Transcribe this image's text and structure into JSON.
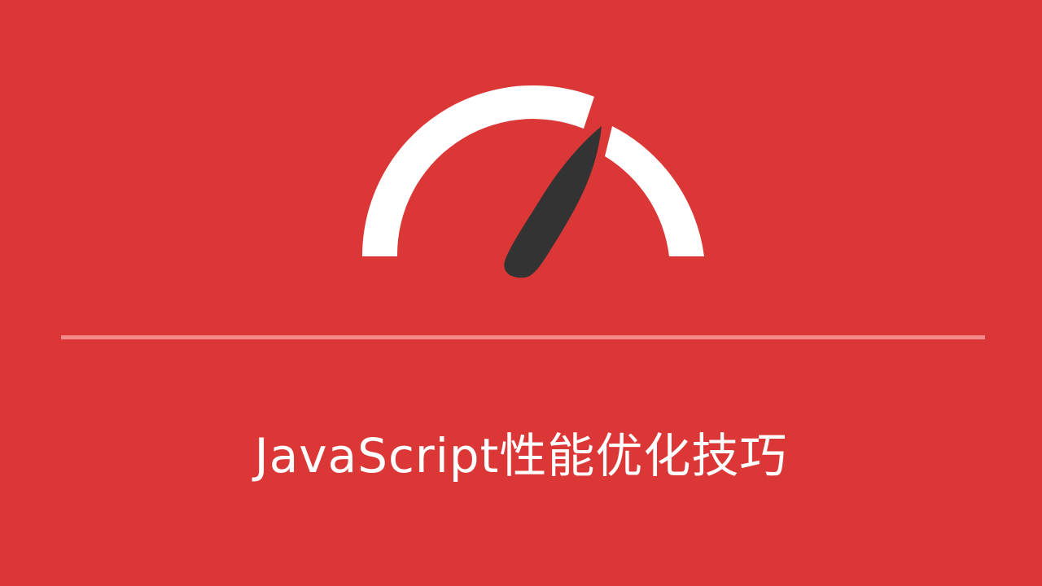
{
  "slide": {
    "title": "JavaScript性能优化技巧"
  },
  "colors": {
    "background": "#DB3736",
    "gauge_arc": "#FFFFFF",
    "gauge_needle": "#333333",
    "divider": "#F28B89",
    "title_text": "#FFFFFF"
  },
  "icons": {
    "gauge": "speedometer-gauge-icon"
  }
}
